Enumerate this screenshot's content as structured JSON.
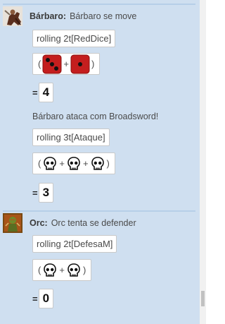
{
  "messages": [
    {
      "author": "Bárbaro:",
      "text": "Bárbaro se move",
      "roll1_cmd": "rolling 2t[RedDice]",
      "roll1_open": "(",
      "roll1_plus": "+",
      "roll1_close": ")",
      "roll1_eq": "=",
      "roll1_total": "4",
      "narration": "Bárbaro ataca com Broadsword!",
      "roll2_cmd": "rolling 3t[Ataque]",
      "roll2_open": "(",
      "roll2_plus1": "+",
      "roll2_plus2": "+",
      "roll2_close": ")",
      "roll2_eq": "=",
      "roll2_total": "3"
    },
    {
      "author": "Orc:",
      "text": "Orc tenta se defender",
      "roll_cmd": "rolling 2t[DefesaM]",
      "roll_open": "(",
      "roll_plus": "+",
      "roll_close": ")",
      "roll_eq": "=",
      "roll_total": "0"
    }
  ],
  "icons": {
    "avatar_1": "barbarian-avatar",
    "avatar_2": "orc-avatar",
    "red_die_3": "red-die-three-pips",
    "red_die_1": "red-die-one-pip",
    "skull": "skull-icon"
  },
  "colors": {
    "chat_background": "#cfdff0",
    "die_red": "#c41e1e",
    "divider": "#b6cfe8"
  }
}
